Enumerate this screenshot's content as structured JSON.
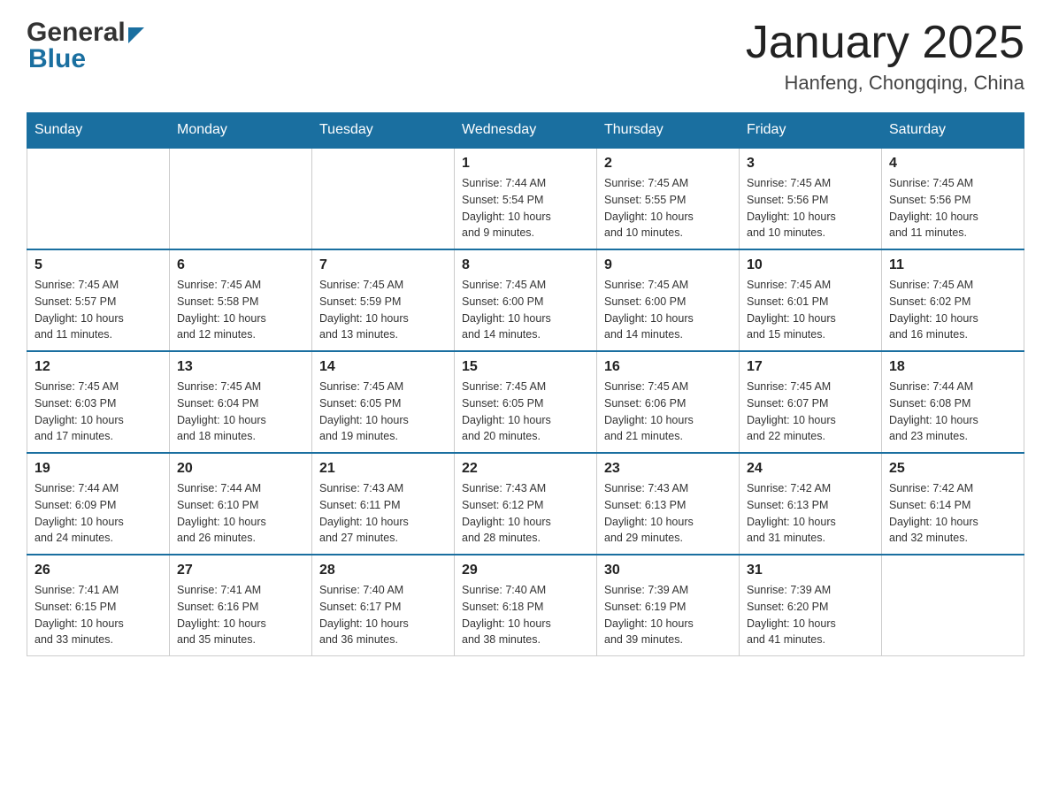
{
  "header": {
    "title": "January 2025",
    "subtitle": "Hanfeng, Chongqing, China",
    "logo_general": "General",
    "logo_blue": "Blue"
  },
  "days_of_week": [
    "Sunday",
    "Monday",
    "Tuesday",
    "Wednesday",
    "Thursday",
    "Friday",
    "Saturday"
  ],
  "weeks": [
    [
      {
        "day": "",
        "info": ""
      },
      {
        "day": "",
        "info": ""
      },
      {
        "day": "",
        "info": ""
      },
      {
        "day": "1",
        "info": "Sunrise: 7:44 AM\nSunset: 5:54 PM\nDaylight: 10 hours\nand 9 minutes."
      },
      {
        "day": "2",
        "info": "Sunrise: 7:45 AM\nSunset: 5:55 PM\nDaylight: 10 hours\nand 10 minutes."
      },
      {
        "day": "3",
        "info": "Sunrise: 7:45 AM\nSunset: 5:56 PM\nDaylight: 10 hours\nand 10 minutes."
      },
      {
        "day": "4",
        "info": "Sunrise: 7:45 AM\nSunset: 5:56 PM\nDaylight: 10 hours\nand 11 minutes."
      }
    ],
    [
      {
        "day": "5",
        "info": "Sunrise: 7:45 AM\nSunset: 5:57 PM\nDaylight: 10 hours\nand 11 minutes."
      },
      {
        "day": "6",
        "info": "Sunrise: 7:45 AM\nSunset: 5:58 PM\nDaylight: 10 hours\nand 12 minutes."
      },
      {
        "day": "7",
        "info": "Sunrise: 7:45 AM\nSunset: 5:59 PM\nDaylight: 10 hours\nand 13 minutes."
      },
      {
        "day": "8",
        "info": "Sunrise: 7:45 AM\nSunset: 6:00 PM\nDaylight: 10 hours\nand 14 minutes."
      },
      {
        "day": "9",
        "info": "Sunrise: 7:45 AM\nSunset: 6:00 PM\nDaylight: 10 hours\nand 14 minutes."
      },
      {
        "day": "10",
        "info": "Sunrise: 7:45 AM\nSunset: 6:01 PM\nDaylight: 10 hours\nand 15 minutes."
      },
      {
        "day": "11",
        "info": "Sunrise: 7:45 AM\nSunset: 6:02 PM\nDaylight: 10 hours\nand 16 minutes."
      }
    ],
    [
      {
        "day": "12",
        "info": "Sunrise: 7:45 AM\nSunset: 6:03 PM\nDaylight: 10 hours\nand 17 minutes."
      },
      {
        "day": "13",
        "info": "Sunrise: 7:45 AM\nSunset: 6:04 PM\nDaylight: 10 hours\nand 18 minutes."
      },
      {
        "day": "14",
        "info": "Sunrise: 7:45 AM\nSunset: 6:05 PM\nDaylight: 10 hours\nand 19 minutes."
      },
      {
        "day": "15",
        "info": "Sunrise: 7:45 AM\nSunset: 6:05 PM\nDaylight: 10 hours\nand 20 minutes."
      },
      {
        "day": "16",
        "info": "Sunrise: 7:45 AM\nSunset: 6:06 PM\nDaylight: 10 hours\nand 21 minutes."
      },
      {
        "day": "17",
        "info": "Sunrise: 7:45 AM\nSunset: 6:07 PM\nDaylight: 10 hours\nand 22 minutes."
      },
      {
        "day": "18",
        "info": "Sunrise: 7:44 AM\nSunset: 6:08 PM\nDaylight: 10 hours\nand 23 minutes."
      }
    ],
    [
      {
        "day": "19",
        "info": "Sunrise: 7:44 AM\nSunset: 6:09 PM\nDaylight: 10 hours\nand 24 minutes."
      },
      {
        "day": "20",
        "info": "Sunrise: 7:44 AM\nSunset: 6:10 PM\nDaylight: 10 hours\nand 26 minutes."
      },
      {
        "day": "21",
        "info": "Sunrise: 7:43 AM\nSunset: 6:11 PM\nDaylight: 10 hours\nand 27 minutes."
      },
      {
        "day": "22",
        "info": "Sunrise: 7:43 AM\nSunset: 6:12 PM\nDaylight: 10 hours\nand 28 minutes."
      },
      {
        "day": "23",
        "info": "Sunrise: 7:43 AM\nSunset: 6:13 PM\nDaylight: 10 hours\nand 29 minutes."
      },
      {
        "day": "24",
        "info": "Sunrise: 7:42 AM\nSunset: 6:13 PM\nDaylight: 10 hours\nand 31 minutes."
      },
      {
        "day": "25",
        "info": "Sunrise: 7:42 AM\nSunset: 6:14 PM\nDaylight: 10 hours\nand 32 minutes."
      }
    ],
    [
      {
        "day": "26",
        "info": "Sunrise: 7:41 AM\nSunset: 6:15 PM\nDaylight: 10 hours\nand 33 minutes."
      },
      {
        "day": "27",
        "info": "Sunrise: 7:41 AM\nSunset: 6:16 PM\nDaylight: 10 hours\nand 35 minutes."
      },
      {
        "day": "28",
        "info": "Sunrise: 7:40 AM\nSunset: 6:17 PM\nDaylight: 10 hours\nand 36 minutes."
      },
      {
        "day": "29",
        "info": "Sunrise: 7:40 AM\nSunset: 6:18 PM\nDaylight: 10 hours\nand 38 minutes."
      },
      {
        "day": "30",
        "info": "Sunrise: 7:39 AM\nSunset: 6:19 PM\nDaylight: 10 hours\nand 39 minutes."
      },
      {
        "day": "31",
        "info": "Sunrise: 7:39 AM\nSunset: 6:20 PM\nDaylight: 10 hours\nand 41 minutes."
      },
      {
        "day": "",
        "info": ""
      }
    ]
  ]
}
